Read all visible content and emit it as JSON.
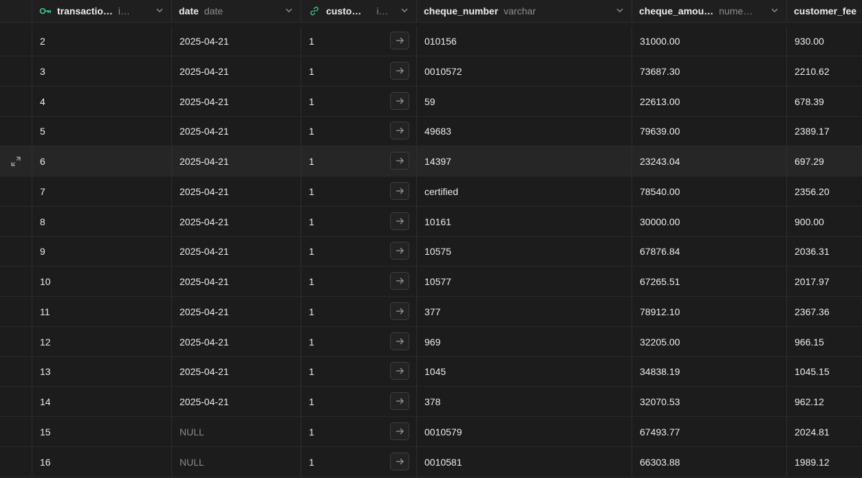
{
  "columns": [
    {
      "name": "transactio…",
      "type": "i…",
      "icon": "key-icon"
    },
    {
      "name": "date",
      "type": "date"
    },
    {
      "name": "custo…",
      "type": "i…",
      "icon": "link-icon"
    },
    {
      "name": "cheque_number",
      "type": "varchar"
    },
    {
      "name": "cheque_amou…",
      "type": "nume…"
    },
    {
      "name": "customer_fee",
      "type": ""
    }
  ],
  "rows": [
    {
      "id": "2",
      "date": "2025-04-21",
      "customer": "1",
      "cheque_number": "010156",
      "cheque_amount": "31000.00",
      "customer_fee": "930.00"
    },
    {
      "id": "3",
      "date": "2025-04-21",
      "customer": "1",
      "cheque_number": "0010572",
      "cheque_amount": "73687.30",
      "customer_fee": "2210.62"
    },
    {
      "id": "4",
      "date": "2025-04-21",
      "customer": "1",
      "cheque_number": "59",
      "cheque_amount": "22613.00",
      "customer_fee": "678.39"
    },
    {
      "id": "5",
      "date": "2025-04-21",
      "customer": "1",
      "cheque_number": "49683",
      "cheque_amount": "79639.00",
      "customer_fee": "2389.17"
    },
    {
      "id": "6",
      "date": "2025-04-21",
      "customer": "1",
      "cheque_number": "14397",
      "cheque_amount": "23243.04",
      "customer_fee": "697.29"
    },
    {
      "id": "7",
      "date": "2025-04-21",
      "customer": "1",
      "cheque_number": "certified",
      "cheque_amount": "78540.00",
      "customer_fee": "2356.20"
    },
    {
      "id": "8",
      "date": "2025-04-21",
      "customer": "1",
      "cheque_number": "10161",
      "cheque_amount": "30000.00",
      "customer_fee": "900.00"
    },
    {
      "id": "9",
      "date": "2025-04-21",
      "customer": "1",
      "cheque_number": "10575",
      "cheque_amount": "67876.84",
      "customer_fee": "2036.31"
    },
    {
      "id": "10",
      "date": "2025-04-21",
      "customer": "1",
      "cheque_number": "10577",
      "cheque_amount": "67265.51",
      "customer_fee": "2017.97"
    },
    {
      "id": "11",
      "date": "2025-04-21",
      "customer": "1",
      "cheque_number": "377",
      "cheque_amount": "78912.10",
      "customer_fee": "2367.36"
    },
    {
      "id": "12",
      "date": "2025-04-21",
      "customer": "1",
      "cheque_number": "969",
      "cheque_amount": "32205.00",
      "customer_fee": "966.15"
    },
    {
      "id": "13",
      "date": "2025-04-21",
      "customer": "1",
      "cheque_number": "1045",
      "cheque_amount": "34838.19",
      "customer_fee": "1045.15"
    },
    {
      "id": "14",
      "date": "2025-04-21",
      "customer": "1",
      "cheque_number": "378",
      "cheque_amount": "32070.53",
      "customer_fee": "962.12"
    },
    {
      "id": "15",
      "date": "NULL",
      "customer": "1",
      "cheque_number": "0010579",
      "cheque_amount": "67493.77",
      "customer_fee": "2024.81"
    },
    {
      "id": "16",
      "date": "NULL",
      "customer": "1",
      "cheque_number": "0010581",
      "cheque_amount": "66303.88",
      "customer_fee": "1989.12"
    }
  ],
  "highlighted_row_id": "6",
  "colors": {
    "background": "#1c1c1c",
    "row_highlight": "#262626",
    "key_accent": "#3ecf8e",
    "link_accent": "#3ecf8e",
    "null_text": "#8a8a8a"
  }
}
